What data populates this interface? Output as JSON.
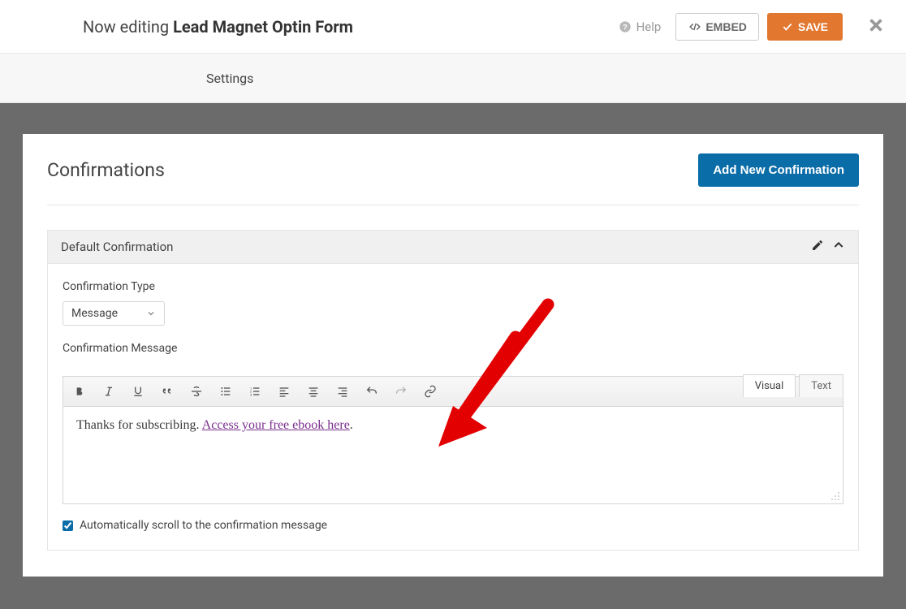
{
  "header": {
    "editing_prefix": "Now editing",
    "form_name": "Lead Magnet Optin Form",
    "help_label": "Help",
    "embed_label": "EMBED",
    "save_label": "SAVE"
  },
  "tabs": {
    "settings_label": "Settings"
  },
  "panel": {
    "title": "Confirmations",
    "add_button_label": "Add New Confirmation"
  },
  "confirmation": {
    "name": "Default Confirmation",
    "type_label": "Confirmation Type",
    "type_value": "Message",
    "message_label": "Confirmation Message",
    "editor_tabs": {
      "visual": "Visual",
      "text": "Text"
    },
    "content_plain": "Thanks for subscribing. ",
    "content_link": "Access your free ebook here",
    "content_suffix": ".",
    "auto_scroll_label": "Automatically scroll to the confirmation message",
    "auto_scroll_checked": true
  }
}
